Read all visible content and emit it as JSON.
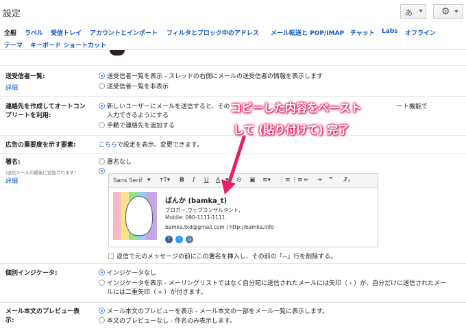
{
  "header": {
    "title": "設定",
    "lang_button": "あ"
  },
  "tabs": [
    {
      "label": "全般",
      "active": true
    },
    {
      "label": "ラベル"
    },
    {
      "label": "受信トレイ"
    },
    {
      "label": "アカウントとインポート"
    },
    {
      "label": "フィルタとブロック中のアドレス"
    },
    {
      "label": "メール転送と POP/IMAP"
    },
    {
      "label": "チャット"
    },
    {
      "label": "Labs"
    },
    {
      "label": "オフライン"
    },
    {
      "label": "テーマ"
    },
    {
      "label": "キーボード ショートカット"
    }
  ],
  "sender_info": {
    "label": "送受信者一覧:",
    "detail": "詳細",
    "opt1_bold": "送受信者一覧を表示",
    "opt1_rest": " - スレッドの右側にメールの送受信者の情報を表示します",
    "opt2": "送受信者一覧を非表示"
  },
  "contacts": {
    "label_line1": "連絡先を作成してオートコン",
    "label_line2": "プリートを利用:",
    "opt1": "新しいユーザーにメールを送信すると、その",
    "opt1_tail": "ート機能で",
    "opt1_line2": "入力できるようにする",
    "opt2": "手動で連絡先を追加する"
  },
  "ads": {
    "label": "広告の重要度を示す要素:",
    "link": "こちら",
    "text": "で設定を表示、変更できます。"
  },
  "signature": {
    "label": "署名:",
    "sublabel": "(送信メールの最後に追加されます)",
    "detail": "詳細",
    "opt_none": "署名なし",
    "toolbar_font": "Sans Serif",
    "name": "ばんか (bamka_t)",
    "line1": "ブロガー,ウェブコンサルタント,",
    "line2": "Mobile: 090-1111-1111",
    "line3": "bamka.tkd@gmail.com | http://bamka.info",
    "checkbox_text": "返信で元のメッセージの前にこの署名を挿入し、その前の「--」行を削除する。"
  },
  "indicator": {
    "label": "個別インジケータ:",
    "opt1": "インジケータなし",
    "opt2_bold": "インジケータを表示",
    "opt2_rest": " - メーリングリストではなく自分宛に送信されたメールには矢印（ › ）が、自分だけに送信されたメー",
    "opt2_line2": "ルには二重矢印（ » ）が付きます。"
  },
  "preview": {
    "label_line1": "メール本文のプレビュー表",
    "label_line2": "示:",
    "opt1_bold": "メール本文のプレビューを表示",
    "opt1_rest": " - メール本文の一部をメール一覧に表示します。",
    "opt2_bold": "本文のプレビューなし",
    "opt2_rest": " - 件名のみ表示します。"
  },
  "annotation": {
    "line1": "コピーした内容をペースト",
    "line2": "して (貼り付けて) 完了"
  },
  "colors": {
    "link": "#1155cc",
    "radio": "#4d90fe",
    "annotation": "#e91e63"
  }
}
